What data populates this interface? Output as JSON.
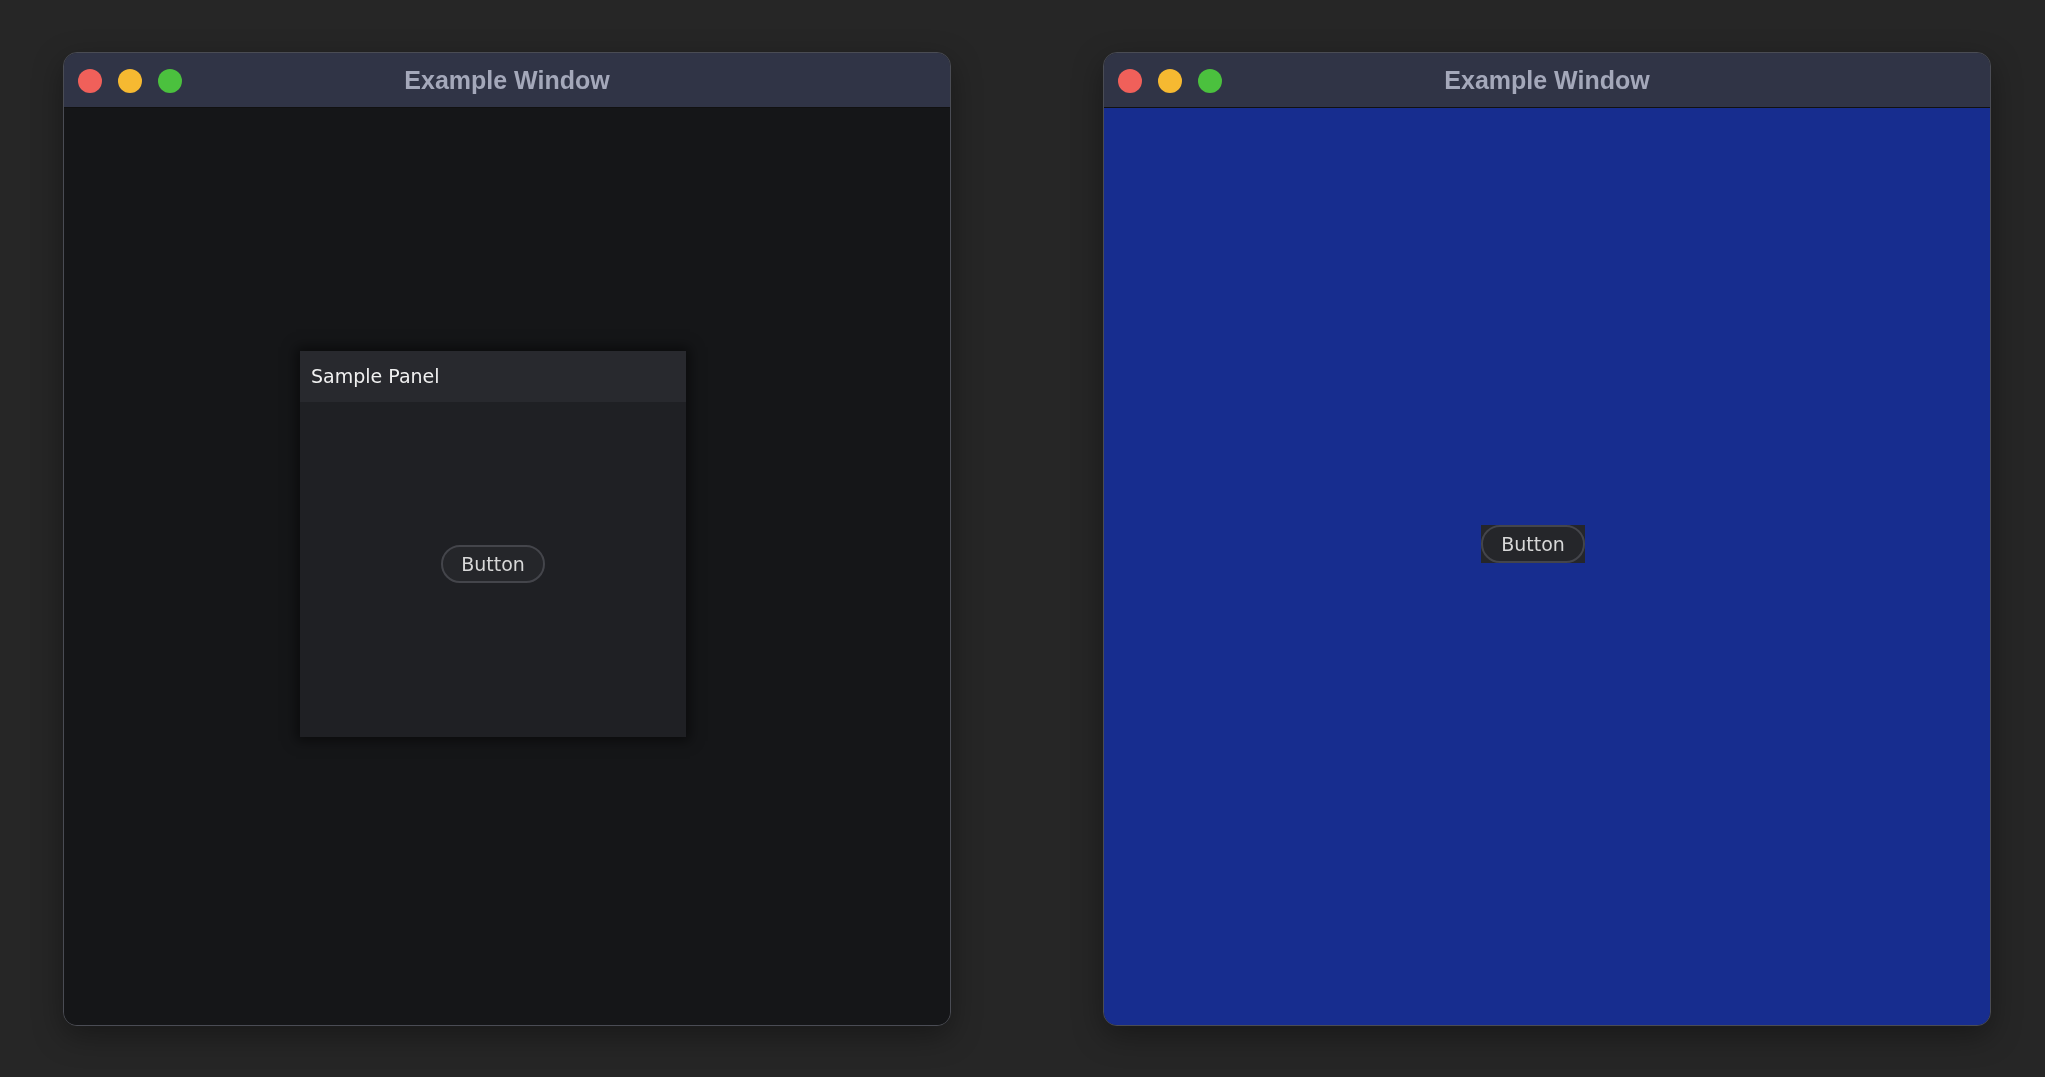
{
  "windows": [
    {
      "title": "Example Window",
      "kind": "panel",
      "panel": {
        "title": "Sample Panel",
        "button": "Button"
      }
    },
    {
      "title": "Example Window",
      "kind": "tinted",
      "button": "Button"
    }
  ]
}
